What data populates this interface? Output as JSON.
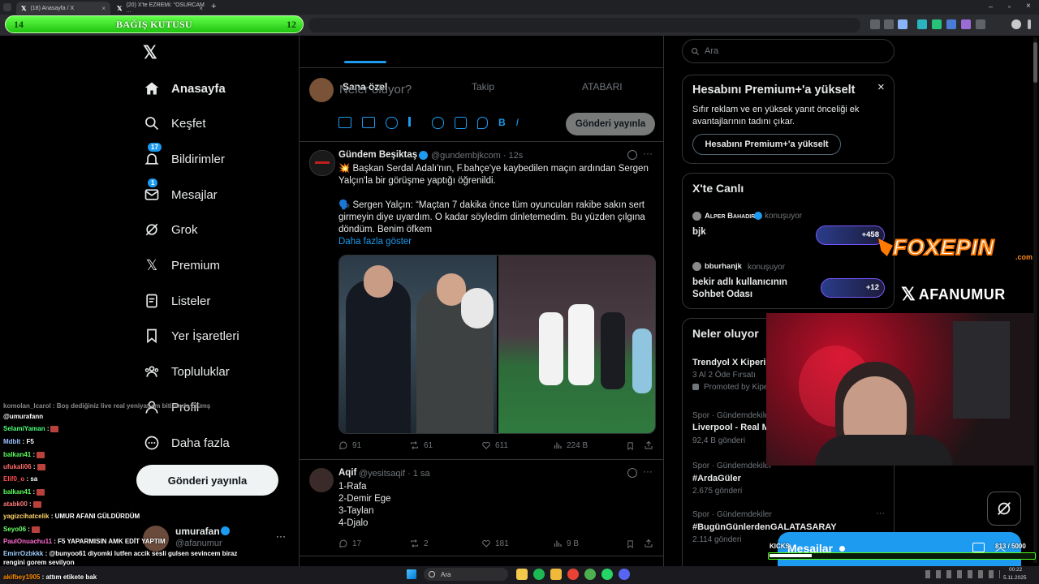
{
  "browser": {
    "tabs": [
      {
        "label": "(18) Anasayfa / X"
      },
      {
        "label": "(20) X'te EZREMi: \"OSURCAM ..."
      }
    ],
    "new_tab": "+"
  },
  "donation_bar": {
    "left_num": "14",
    "title": "BAĞIŞ KUTUSU",
    "right_num": "12"
  },
  "sidebar": {
    "items": [
      {
        "label": "Anasayfa"
      },
      {
        "label": "Keşfet"
      },
      {
        "label": "Bildirimler",
        "badge": "17"
      },
      {
        "label": "Mesajlar",
        "badge": "1"
      },
      {
        "label": "Grok"
      },
      {
        "label": "Premium"
      },
      {
        "label": "Listeler"
      },
      {
        "label": "Yer İşaretleri"
      },
      {
        "label": "Topluluklar"
      },
      {
        "label": "Profil"
      },
      {
        "label": "Daha fazla"
      }
    ],
    "post_button": "Gönderi yayınla",
    "account": {
      "name": "umurafan",
      "handle": "@afanumur",
      "more": "···"
    }
  },
  "feed": {
    "tabs": [
      {
        "label": "Sana özel"
      },
      {
        "label": "Takip"
      },
      {
        "label": "ATABARI"
      }
    ],
    "composer": {
      "placeholder": "Neler oluyor?",
      "post_button": "Gönderi yayınla"
    },
    "tweets": [
      {
        "name": "Gündem Beşiktaş",
        "handle": "@gundembjkcom · 12s",
        "line1": "💥 Başkan Serdal Adalı'nın, F.bahçe'ye kaybedilen maçın ardından Sergen",
        "line2": "Yalçın'la bir görüşme yaptığı öğrenildi.",
        "line3": "🗣️ Sergen Yalçın: “Maçtan 7 dakika önce tüm oyuncuları rakibe sakın sert",
        "line4": "girmeyin diye uyardım. O kadar söyledim dinletemedim. Bu yüzden çılgına",
        "line5": "döndüm. Benim öfkem",
        "show_more": "Daha fazla göster",
        "stats": {
          "replies": "91",
          "reposts": "61",
          "likes": "611",
          "views": "224 B"
        }
      },
      {
        "name": "Aqif",
        "handle": "@yesitsaqif · 1 sa",
        "lines": [
          "1-Rafa",
          "2-Demir Ege",
          "3-Taylan",
          "4-Djalo"
        ],
        "stats": {
          "replies": "17",
          "reposts": "2",
          "likes": "181",
          "views": "9 B"
        }
      }
    ]
  },
  "right": {
    "search_placeholder": "Ara",
    "premium": {
      "title": "Hesabını Premium+'a yükselt",
      "desc1": "Sıfır reklam ve en yüksek yanıt önceliği ek",
      "desc2": "avantajlarının tadını çıkar.",
      "button": "Hesabını Premium+'a yükselt",
      "close": "×"
    },
    "live": {
      "title": "X'te Canlı",
      "items": [
        {
          "host": "Alper Bahadır",
          "status": "konuşuyor",
          "title": "bjk",
          "count": "+458"
        },
        {
          "host": "bburhanjk",
          "status": "konuşuyor",
          "title1": "bekir adlı kullanıcının",
          "title2": "Sohbet Odası",
          "count": "+12"
        }
      ]
    },
    "whats_happening": {
      "title": "Neler oluyor",
      "items": [
        {
          "title": "Trendyol X Kiperi",
          "sub": "3 Al 2 Öde Fırsatı",
          "promo": "Promoted by Kipe"
        },
        {
          "cat": "Spor · Gündemdekiler",
          "title": "Liverpool - Real M",
          "count": "92,4 B gönderi"
        },
        {
          "cat": "Spor · Gündemdekiler",
          "title": "#ArdaGüler",
          "count": "2.675 gönderi"
        },
        {
          "cat": "Spor · Gündemdekiler",
          "title": "#BugünGünlerdenGALATASARAY",
          "count": "2.114 gönderi"
        }
      ]
    }
  },
  "overlays": {
    "foxepin": "FOXEPIN",
    "foxepin_com": ".com",
    "afanumur": "AFANUMUR",
    "kick_label": "KICKS",
    "kick_progress": "813 / 5000",
    "kick_progress_fraction": 0.16,
    "messages_drawer": "Mesajlar"
  },
  "chat": [
    {
      "user": "@umurafann",
      "msg": "",
      "color": "#ffffff"
    },
    {
      "user": "SelamiYaman",
      "msg": " :",
      "color": "#4cff7a"
    },
    {
      "user": "Mdblt",
      "msg": " : F5",
      "color": "#9cc0ff"
    },
    {
      "user": "balkan41",
      "msg": " :",
      "color": "#5cff5c"
    },
    {
      "user": "ufukali06",
      "msg": " :",
      "color": "#ff6b6b"
    },
    {
      "user": "Elif0_o",
      "msg": " : sa",
      "color": "#ff5050"
    },
    {
      "user": "balkan41",
      "msg": " :",
      "color": "#5cff5c"
    },
    {
      "user": "atabk00",
      "msg": " :",
      "color": "#ff7a7a"
    },
    {
      "user": "yagizcihatcelik",
      "msg": " : UMUR AFANI GÜLDÜRDÜM",
      "color": "#ffd36b"
    },
    {
      "user": "Seyo06",
      "msg": " :",
      "color": "#6bff6b"
    },
    {
      "user": "PaulOnuachu11",
      "msg": " : F5 YAPARMISIN AMK EDİT YAPTIM",
      "color": "#ff6bd0"
    },
    {
      "user": "EmirrOzbkkk",
      "msg": " : @bunyoo61 diyomki lutfen accik sesli gulsen sevincem biraz",
      "color": "#a0d0ff"
    },
    {
      "user": "",
      "msg": "rengini gorem sevilyon",
      "color": "#ffffff"
    },
    {
      "user": "akifbey1905",
      "msg": " : attım etikete bak",
      "color": "#ff8c00"
    }
  ],
  "taskbar": {
    "search": "Ara",
    "time": "00:22",
    "date": "5.11.2025"
  },
  "colors": {
    "accent": "#1d9bf0",
    "donation": "#3be62a",
    "kick": "#53fc18"
  }
}
